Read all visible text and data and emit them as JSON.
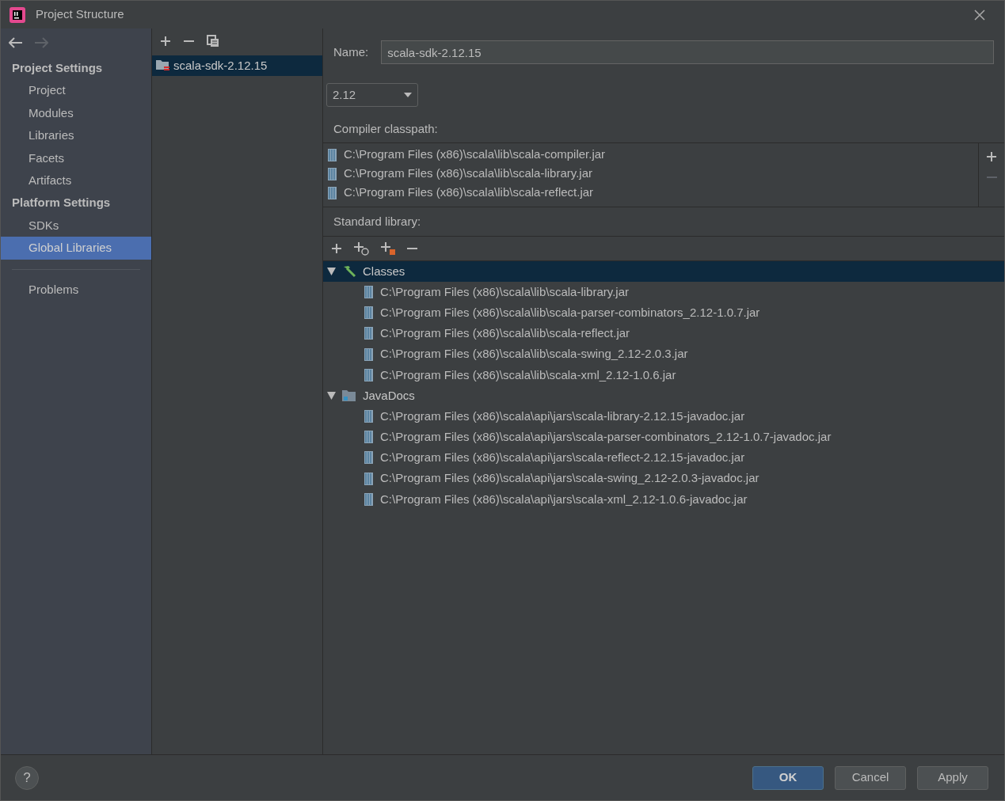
{
  "window": {
    "title": "Project Structure"
  },
  "sidebar": {
    "sections": [
      {
        "title": "Project Settings",
        "items": [
          {
            "label": "Project",
            "selected": false
          },
          {
            "label": "Modules",
            "selected": false
          },
          {
            "label": "Libraries",
            "selected": false
          },
          {
            "label": "Facets",
            "selected": false
          },
          {
            "label": "Artifacts",
            "selected": false
          }
        ]
      },
      {
        "title": "Platform Settings",
        "items": [
          {
            "label": "SDKs",
            "selected": false
          },
          {
            "label": "Global Libraries",
            "selected": true
          }
        ]
      }
    ],
    "bottom_items": [
      {
        "label": "Problems",
        "selected": false
      }
    ]
  },
  "library_list": {
    "items": [
      {
        "label": "scala-sdk-2.12.15",
        "selected": true
      }
    ]
  },
  "details": {
    "name_label": "Name:",
    "name_value": "scala-sdk-2.12.15",
    "version": "2.12",
    "compiler_classpath_label": "Compiler classpath:",
    "compiler_classpath": [
      "C:\\Program Files (x86)\\scala\\lib\\scala-compiler.jar",
      "C:\\Program Files (x86)\\scala\\lib\\scala-library.jar",
      "C:\\Program Files (x86)\\scala\\lib\\scala-reflect.jar"
    ],
    "standard_library_label": "Standard library:",
    "tree": [
      {
        "label": "Classes",
        "kind": "classes",
        "expanded": true,
        "selected": true,
        "children": [
          {
            "label": "C:\\Program Files (x86)\\scala\\lib\\scala-library.jar"
          },
          {
            "label": "C:\\Program Files (x86)\\scala\\lib\\scala-parser-combinators_2.12-1.0.7.jar"
          },
          {
            "label": "C:\\Program Files (x86)\\scala\\lib\\scala-reflect.jar"
          },
          {
            "label": "C:\\Program Files (x86)\\scala\\lib\\scala-swing_2.12-2.0.3.jar"
          },
          {
            "label": "C:\\Program Files (x86)\\scala\\lib\\scala-xml_2.12-1.0.6.jar"
          }
        ]
      },
      {
        "label": "JavaDocs",
        "kind": "javadocs",
        "expanded": true,
        "selected": false,
        "children": [
          {
            "label": "C:\\Program Files (x86)\\scala\\api\\jars\\scala-library-2.12.15-javadoc.jar"
          },
          {
            "label": "C:\\Program Files (x86)\\scala\\api\\jars\\scala-parser-combinators_2.12-1.0.7-javadoc.jar"
          },
          {
            "label": "C:\\Program Files (x86)\\scala\\api\\jars\\scala-reflect-2.12.15-javadoc.jar"
          },
          {
            "label": "C:\\Program Files (x86)\\scala\\api\\jars\\scala-swing_2.12-2.0.3-javadoc.jar"
          },
          {
            "label": "C:\\Program Files (x86)\\scala\\api\\jars\\scala-xml_2.12-1.0.6-javadoc.jar"
          }
        ]
      }
    ]
  },
  "help": "?",
  "buttons": [
    "OK",
    "Cancel",
    "Apply"
  ]
}
